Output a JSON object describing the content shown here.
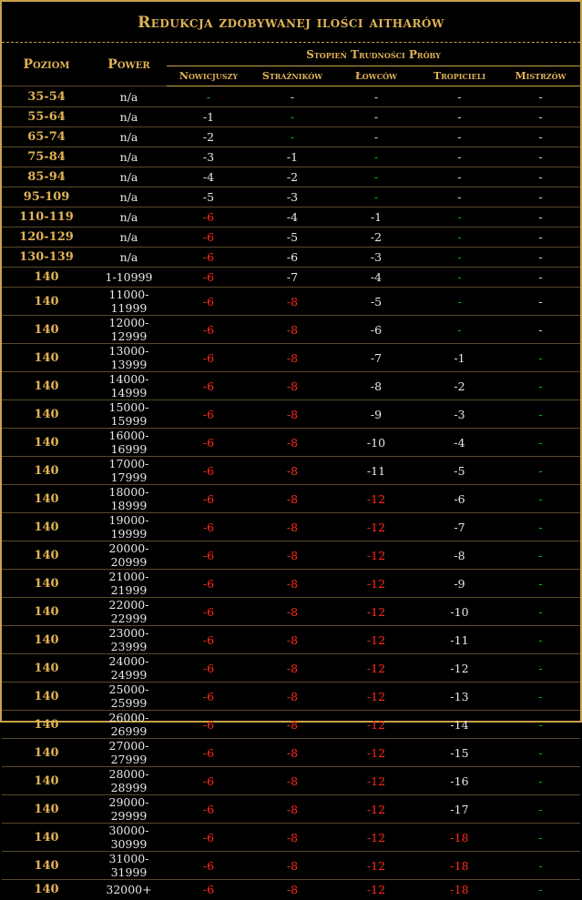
{
  "title": "Redukcja zdobywanej ilości aitharów",
  "headers": {
    "level": "Poziom",
    "power": "Power",
    "difficulty_group": "Stopień Trudności Próby",
    "difficulties": [
      "Nowicjuszy",
      "Strażników",
      "Łowców",
      "Tropicieli",
      "Mistrzów"
    ]
  },
  "colors": {
    "gold": "#e0b356",
    "red": "#ff2a1a",
    "green": "#18c018",
    "white": "#e8e8e8"
  },
  "rows": [
    {
      "level": "35-54",
      "power": "n/a",
      "values": [
        "-",
        "-",
        "-",
        "-",
        "-"
      ],
      "colors": [
        "green",
        "white",
        "white",
        "white",
        "white"
      ]
    },
    {
      "level": "55-64",
      "power": "n/a",
      "values": [
        "-1",
        "-",
        "-",
        "-",
        "-"
      ],
      "colors": [
        "white",
        "green",
        "white",
        "white",
        "white"
      ]
    },
    {
      "level": "65-74",
      "power": "n/a",
      "values": [
        "-2",
        "-",
        "-",
        "-",
        "-"
      ],
      "colors": [
        "white",
        "green",
        "white",
        "white",
        "white"
      ]
    },
    {
      "level": "75-84",
      "power": "n/a",
      "values": [
        "-3",
        "-1",
        "-",
        "-",
        "-"
      ],
      "colors": [
        "white",
        "white",
        "green",
        "white",
        "white"
      ]
    },
    {
      "level": "85-94",
      "power": "n/a",
      "values": [
        "-4",
        "-2",
        "-",
        "-",
        "-"
      ],
      "colors": [
        "white",
        "white",
        "green",
        "white",
        "white"
      ]
    },
    {
      "level": "95-109",
      "power": "n/a",
      "values": [
        "-5",
        "-3",
        "-",
        "-",
        "-"
      ],
      "colors": [
        "white",
        "white",
        "green",
        "white",
        "white"
      ]
    },
    {
      "level": "110-119",
      "power": "n/a",
      "values": [
        "-6",
        "-4",
        "-1",
        "-",
        "-"
      ],
      "colors": [
        "red",
        "white",
        "white",
        "green",
        "white"
      ]
    },
    {
      "level": "120-129",
      "power": "n/a",
      "values": [
        "-6",
        "-5",
        "-2",
        "-",
        "-"
      ],
      "colors": [
        "red",
        "white",
        "white",
        "green",
        "white"
      ]
    },
    {
      "level": "130-139",
      "power": "n/a",
      "values": [
        "-6",
        "-6",
        "-3",
        "-",
        "-"
      ],
      "colors": [
        "red",
        "white",
        "white",
        "green",
        "white"
      ]
    },
    {
      "level": "140",
      "power": "1-10999",
      "values": [
        "-6",
        "-7",
        "-4",
        "-",
        "-"
      ],
      "colors": [
        "red",
        "white",
        "white",
        "green",
        "white"
      ]
    },
    {
      "level": "140",
      "power": "11000-11999",
      "values": [
        "-6",
        "-8",
        "-5",
        "-",
        "-"
      ],
      "colors": [
        "red",
        "red",
        "white",
        "green",
        "white"
      ]
    },
    {
      "level": "140",
      "power": "12000-12999",
      "values": [
        "-6",
        "-8",
        "-6",
        "-",
        "-"
      ],
      "colors": [
        "red",
        "red",
        "white",
        "green",
        "white"
      ]
    },
    {
      "level": "140",
      "power": "13000-13999",
      "values": [
        "-6",
        "-8",
        "-7",
        "-1",
        "-"
      ],
      "colors": [
        "red",
        "red",
        "white",
        "white",
        "green"
      ]
    },
    {
      "level": "140",
      "power": "14000-14999",
      "values": [
        "-6",
        "-8",
        "-8",
        "-2",
        "-"
      ],
      "colors": [
        "red",
        "red",
        "white",
        "white",
        "green"
      ]
    },
    {
      "level": "140",
      "power": "15000-15999",
      "values": [
        "-6",
        "-8",
        "-9",
        "-3",
        "-"
      ],
      "colors": [
        "red",
        "red",
        "white",
        "white",
        "green"
      ]
    },
    {
      "level": "140",
      "power": "16000-16999",
      "values": [
        "-6",
        "-8",
        "-10",
        "-4",
        "-"
      ],
      "colors": [
        "red",
        "red",
        "white",
        "white",
        "green"
      ]
    },
    {
      "level": "140",
      "power": "17000-17999",
      "values": [
        "-6",
        "-8",
        "-11",
        "-5",
        "-"
      ],
      "colors": [
        "red",
        "red",
        "white",
        "white",
        "green"
      ]
    },
    {
      "level": "140",
      "power": "18000-18999",
      "values": [
        "-6",
        "-8",
        "-12",
        "-6",
        "-"
      ],
      "colors": [
        "red",
        "red",
        "red",
        "white",
        "green"
      ]
    },
    {
      "level": "140",
      "power": "19000-19999",
      "values": [
        "-6",
        "-8",
        "-12",
        "-7",
        "-"
      ],
      "colors": [
        "red",
        "red",
        "red",
        "white",
        "green"
      ]
    },
    {
      "level": "140",
      "power": "20000-20999",
      "values": [
        "-6",
        "-8",
        "-12",
        "-8",
        "-"
      ],
      "colors": [
        "red",
        "red",
        "red",
        "white",
        "green"
      ]
    },
    {
      "level": "140",
      "power": "21000-21999",
      "values": [
        "-6",
        "-8",
        "-12",
        "-9",
        "-"
      ],
      "colors": [
        "red",
        "red",
        "red",
        "white",
        "green"
      ]
    },
    {
      "level": "140",
      "power": "22000-22999",
      "values": [
        "-6",
        "-8",
        "-12",
        "-10",
        "-"
      ],
      "colors": [
        "red",
        "red",
        "red",
        "white",
        "green"
      ]
    },
    {
      "level": "140",
      "power": "23000-23999",
      "values": [
        "-6",
        "-8",
        "-12",
        "-11",
        "-"
      ],
      "colors": [
        "red",
        "red",
        "red",
        "white",
        "green"
      ]
    },
    {
      "level": "140",
      "power": "24000-24999",
      "values": [
        "-6",
        "-8",
        "-12",
        "-12",
        "-"
      ],
      "colors": [
        "red",
        "red",
        "red",
        "white",
        "green"
      ]
    },
    {
      "level": "140",
      "power": "25000-25999",
      "values": [
        "-6",
        "-8",
        "-12",
        "-13",
        "-"
      ],
      "colors": [
        "red",
        "red",
        "red",
        "white",
        "green"
      ]
    },
    {
      "level": "140",
      "power": "26000-26999",
      "values": [
        "-6",
        "-8",
        "-12",
        "-14",
        "-"
      ],
      "colors": [
        "red",
        "red",
        "red",
        "white",
        "green"
      ]
    },
    {
      "level": "140",
      "power": "27000-27999",
      "values": [
        "-6",
        "-8",
        "-12",
        "-15",
        "-"
      ],
      "colors": [
        "red",
        "red",
        "red",
        "white",
        "green"
      ]
    },
    {
      "level": "140",
      "power": "28000-28999",
      "values": [
        "-6",
        "-8",
        "-12",
        "-16",
        "-"
      ],
      "colors": [
        "red",
        "red",
        "red",
        "white",
        "green"
      ]
    },
    {
      "level": "140",
      "power": "29000-29999",
      "values": [
        "-6",
        "-8",
        "-12",
        "-17",
        "-"
      ],
      "colors": [
        "red",
        "red",
        "red",
        "white",
        "green"
      ]
    },
    {
      "level": "140",
      "power": "30000-30999",
      "values": [
        "-6",
        "-8",
        "-12",
        "-18",
        "-"
      ],
      "colors": [
        "red",
        "red",
        "red",
        "red",
        "green"
      ]
    },
    {
      "level": "140",
      "power": "31000-31999",
      "values": [
        "-6",
        "-8",
        "-12",
        "-18",
        "-"
      ],
      "colors": [
        "red",
        "red",
        "red",
        "red",
        "green"
      ]
    },
    {
      "level": "140",
      "power": "32000+",
      "values": [
        "-6",
        "-8",
        "-12",
        "-18",
        "-"
      ],
      "colors": [
        "red",
        "red",
        "red",
        "red",
        "green"
      ]
    }
  ]
}
